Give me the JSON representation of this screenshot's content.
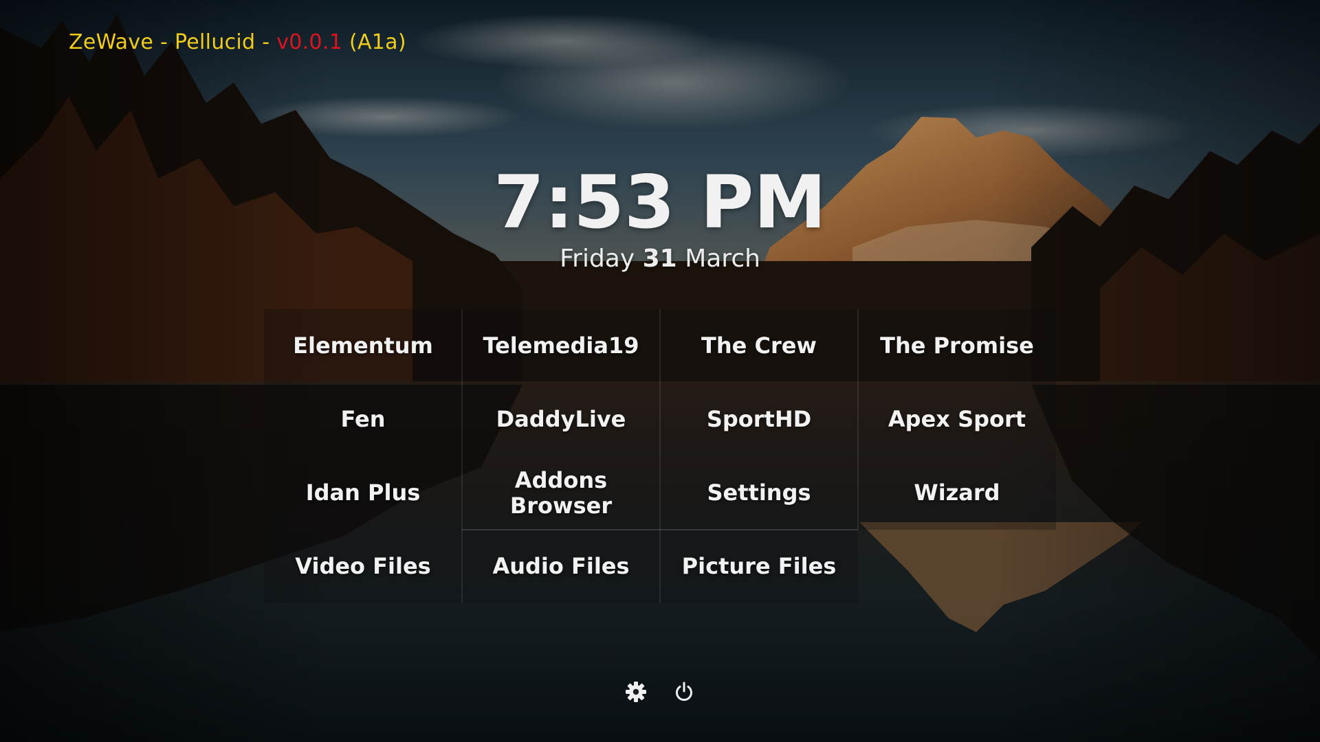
{
  "header": {
    "app_name": "ZeWave",
    "sep1": " - ",
    "skin_name": "Pellucid",
    "sep2": " - ",
    "version": "v0.0.1",
    "build": " (A1a)"
  },
  "clock": {
    "time": "7:53 PM",
    "weekday": "Friday",
    "day": "31",
    "month": "March"
  },
  "menu": {
    "rows": [
      [
        "Elementum",
        "Telemedia19",
        "The Crew",
        "The Promise"
      ],
      [
        "Fen",
        "DaddyLive",
        "SportHD",
        "Apex Sport"
      ],
      [
        "Idan Plus",
        "Addons Browser",
        "Settings",
        "Wizard"
      ],
      [
        "Video Files",
        "Audio Files",
        "Picture Files"
      ]
    ]
  },
  "footer": {
    "icons": [
      "gear-icon",
      "power-icon"
    ]
  },
  "colors": {
    "title_yellow": "#f2cc1a",
    "version_red": "#e0141e",
    "text_white": "#f2f2f2"
  }
}
